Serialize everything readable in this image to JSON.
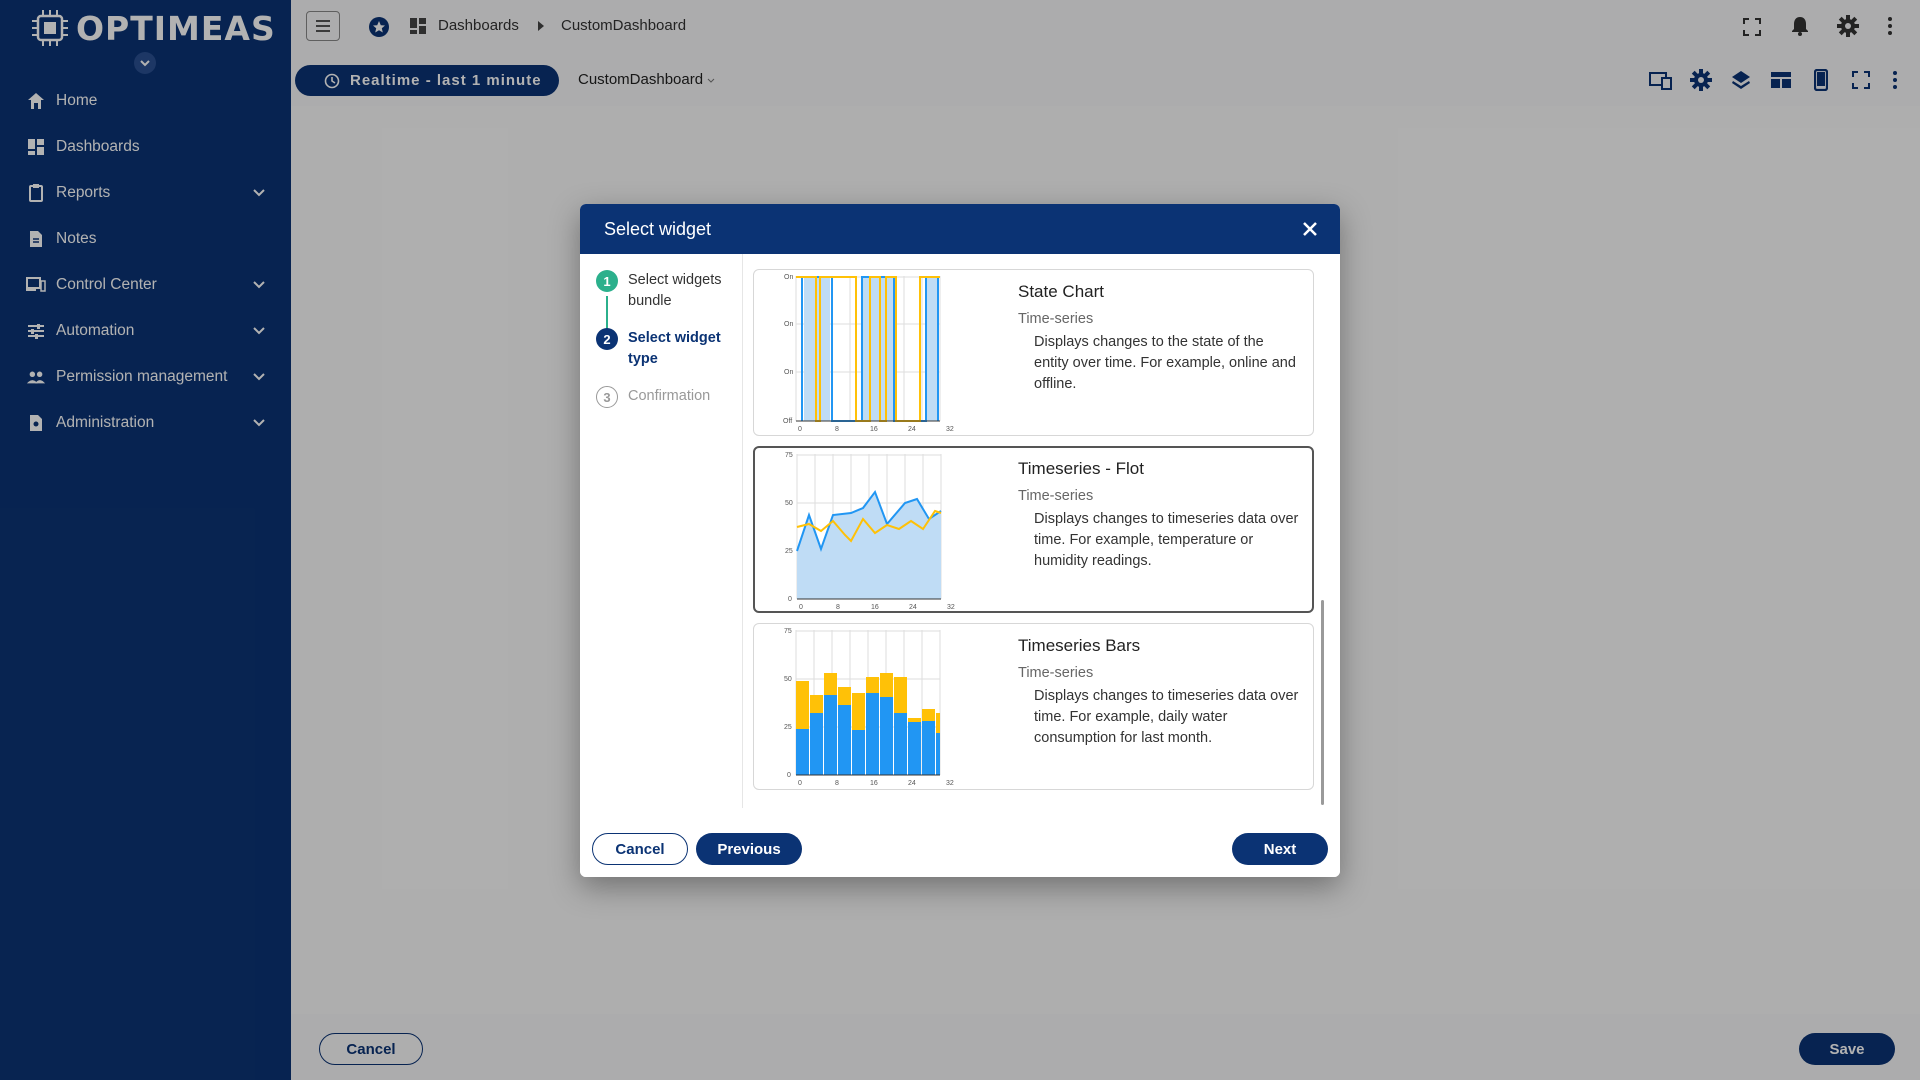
{
  "app": {
    "brand": "OPTIMEAS"
  },
  "sidebar": {
    "items": [
      {
        "label": "Home",
        "icon": "home-icon",
        "expandable": false
      },
      {
        "label": "Dashboards",
        "icon": "dashboards-icon",
        "expandable": false
      },
      {
        "label": "Reports",
        "icon": "reports-icon",
        "expandable": true
      },
      {
        "label": "Notes",
        "icon": "notes-icon",
        "expandable": false
      },
      {
        "label": "Control Center",
        "icon": "devices-icon",
        "expandable": true
      },
      {
        "label": "Automation",
        "icon": "tune-icon",
        "expandable": true
      },
      {
        "label": "Permission management",
        "icon": "people-icon",
        "expandable": true
      },
      {
        "label": "Administration",
        "icon": "admin-icon",
        "expandable": true
      }
    ]
  },
  "header": {
    "breadcrumb": [
      "Dashboards",
      "CustomDashboard"
    ]
  },
  "toolbar": {
    "realtime_label": "Realtime - last 1 minute",
    "dashboard_select": "CustomDashboard"
  },
  "footer": {
    "cancel_label": "Cancel",
    "save_label": "Save"
  },
  "dialog": {
    "title": "Select widget",
    "steps": [
      {
        "number": "1",
        "label": "Select widgets bundle",
        "state": "completed"
      },
      {
        "number": "2",
        "label": "Select widget type",
        "state": "active"
      },
      {
        "number": "3",
        "label": "Confirmation",
        "state": "pending"
      }
    ],
    "widgets": [
      {
        "title": "State Chart",
        "category": "Time-series",
        "description": "Displays changes to the state of the entity over time. For example, online and offline.",
        "selected": false
      },
      {
        "title": "Timeseries - Flot",
        "category": "Time-series",
        "description": "Displays changes to timeseries data over time. For example, temperature or humidity readings.",
        "selected": true
      },
      {
        "title": "Timeseries Bars",
        "category": "Time-series",
        "description": "Displays changes to timeseries data over time. For example, daily water consumption for last month.",
        "selected": false
      }
    ],
    "buttons": {
      "cancel": "Cancel",
      "previous": "Previous",
      "next": "Next"
    },
    "preview_axis": {
      "x_ticks": [
        "0",
        "8",
        "16",
        "24",
        "32"
      ],
      "y_ticks_numeric": [
        "75",
        "50",
        "25",
        "0"
      ],
      "y_ticks_state": [
        "On",
        "On",
        "On",
        "Off"
      ]
    }
  },
  "colors": {
    "brand": "#0b3374",
    "step_done": "#2bb08c",
    "series_blue": "#2196f3",
    "series_yellow": "#ffc107"
  }
}
